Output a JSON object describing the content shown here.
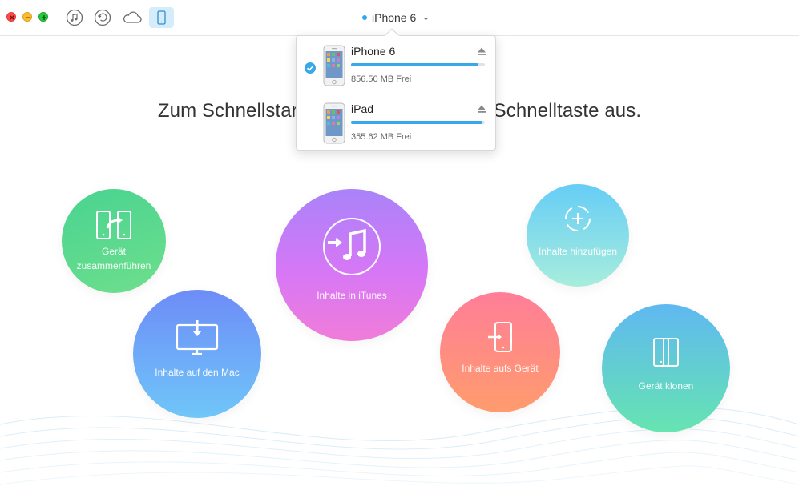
{
  "toolbar": {
    "icons": [
      "music-icon",
      "restore-icon",
      "cloud-icon",
      "phone-icon"
    ],
    "device_selector": "iPhone 6"
  },
  "headline": "Zum Schnellstart wählen Sie bitte eine Schnelltaste aus.",
  "actions": {
    "merge": {
      "line1": "Gerät",
      "line2": "zusammenführen"
    },
    "itunes": "Inhalte in iTunes",
    "add": "Inhalte hinzufügen",
    "mac": "Inhalte auf den Mac",
    "device": "Inhalte aufs Gerät",
    "clone": "Gerät klonen"
  },
  "devices": [
    {
      "name": "iPhone 6",
      "free": "856.50 MB Frei",
      "used_fraction": 0.95,
      "selected": true
    },
    {
      "name": "iPad",
      "free": "355.62 MB Frei",
      "used_fraction": 0.98,
      "selected": false
    }
  ],
  "colors": {
    "accent": "#38a8e8",
    "merge": "#5cd98e",
    "itunes": "#c77ef7",
    "add": "#86dde9",
    "mac": "#6fa9f7",
    "device": "#ff8a85",
    "clone": "#62cfcf"
  }
}
